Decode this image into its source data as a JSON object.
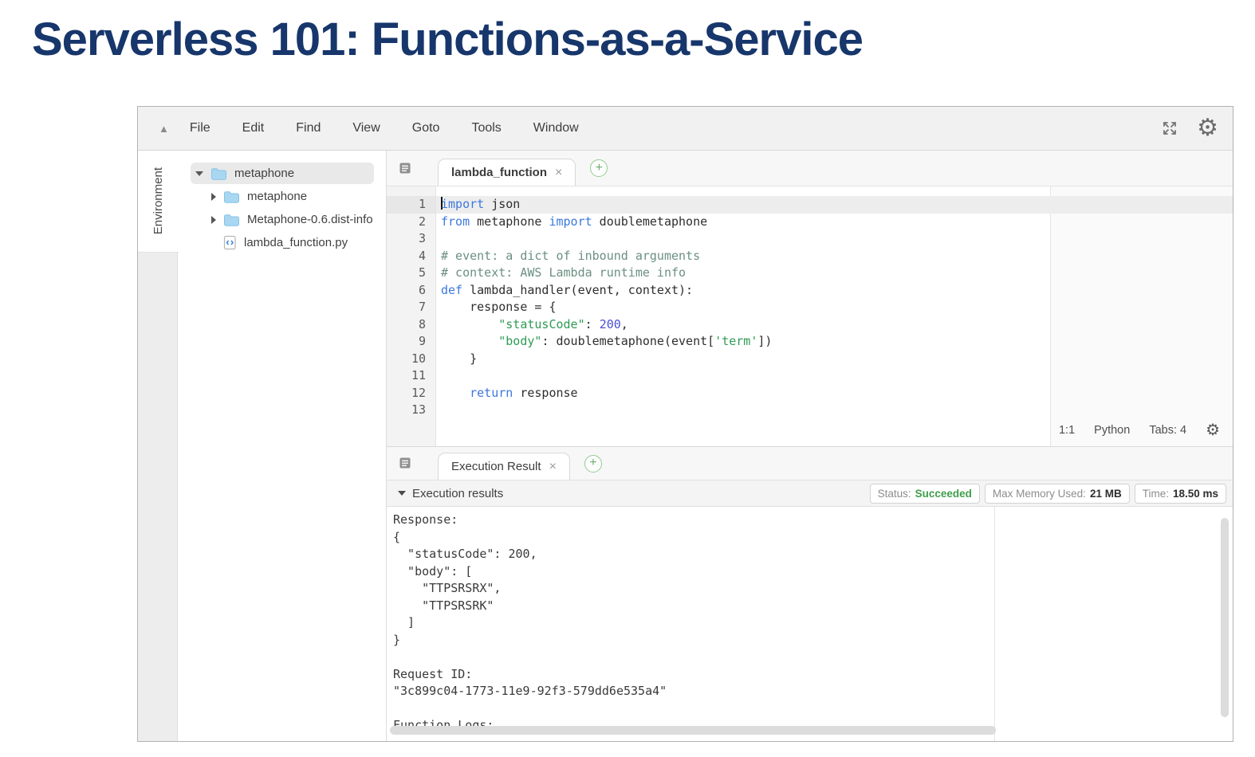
{
  "slide": {
    "title": "Serverless 101: Functions-as-a-Service"
  },
  "colors": {
    "title": "#17366b",
    "keyword": "#3c78dd",
    "string": "#2e9b54",
    "number": "#4a4fd0",
    "comment": "#6b9080",
    "status_green": "#3f9e49"
  },
  "menu_bar": {
    "collapse_icon": "▲",
    "items": [
      "File",
      "Edit",
      "Find",
      "View",
      "Goto",
      "Tools",
      "Window"
    ],
    "gear_icon": "⚙"
  },
  "sidebar": {
    "environment_tab": "Environment"
  },
  "file_tree": {
    "items": [
      {
        "label": "metaphone",
        "kind": "folder",
        "state": "expanded",
        "selected": true,
        "level": 0
      },
      {
        "label": "metaphone",
        "kind": "folder",
        "state": "collapsed",
        "selected": false,
        "level": 1
      },
      {
        "label": "Metaphone-0.6.dist-info",
        "kind": "folder",
        "state": "collapsed",
        "selected": false,
        "level": 1
      },
      {
        "label": "lambda_function.py",
        "kind": "file",
        "state": "none",
        "selected": false,
        "level": 1
      }
    ]
  },
  "editor": {
    "tab_label": "lambda_function",
    "tab_close": "×",
    "new_tab": "+",
    "code": [
      {
        "n": "1",
        "active": true,
        "tokens": [
          [
            "keyword",
            "import"
          ],
          [
            "text",
            " json"
          ]
        ]
      },
      {
        "n": "2",
        "active": false,
        "tokens": [
          [
            "keyword",
            "from"
          ],
          [
            "text",
            " metaphone "
          ],
          [
            "keyword",
            "import"
          ],
          [
            "text",
            " doublemetaphone"
          ]
        ]
      },
      {
        "n": "3",
        "active": false,
        "tokens": []
      },
      {
        "n": "4",
        "active": false,
        "tokens": [
          [
            "comment",
            "# event: a dict of inbound arguments"
          ]
        ]
      },
      {
        "n": "5",
        "active": false,
        "tokens": [
          [
            "comment",
            "# context: AWS Lambda runtime info"
          ]
        ]
      },
      {
        "n": "6",
        "active": false,
        "tokens": [
          [
            "keyword",
            "def"
          ],
          [
            "text",
            " lambda_handler(event, context):"
          ]
        ]
      },
      {
        "n": "7",
        "active": false,
        "tokens": [
          [
            "text",
            "    response = {"
          ]
        ]
      },
      {
        "n": "8",
        "active": false,
        "tokens": [
          [
            "text",
            "        "
          ],
          [
            "string",
            "\"statusCode\""
          ],
          [
            "text",
            ": "
          ],
          [
            "number",
            "200"
          ],
          [
            "text",
            ","
          ]
        ]
      },
      {
        "n": "9",
        "active": false,
        "tokens": [
          [
            "text",
            "        "
          ],
          [
            "string",
            "\"body\""
          ],
          [
            "text",
            ": doublemetaphone(event["
          ],
          [
            "string",
            "'term'"
          ],
          [
            "text",
            "])"
          ]
        ]
      },
      {
        "n": "10",
        "active": false,
        "tokens": [
          [
            "text",
            "    }"
          ]
        ]
      },
      {
        "n": "11",
        "active": false,
        "tokens": []
      },
      {
        "n": "12",
        "active": false,
        "tokens": [
          [
            "text",
            "    "
          ],
          [
            "keyword",
            "return"
          ],
          [
            "text",
            " response"
          ]
        ]
      },
      {
        "n": "13",
        "active": false,
        "tokens": []
      }
    ],
    "status_bar": {
      "cursor": "1:1",
      "language": "Python",
      "tabs": "Tabs: 4",
      "gear_icon": "⚙"
    }
  },
  "execution": {
    "tab_label": "Execution Result",
    "tab_close": "×",
    "new_tab": "+",
    "section_title": "Execution results",
    "badges": [
      {
        "label": "Status:",
        "value": "Succeeded",
        "green": true
      },
      {
        "label": "Max Memory Used:",
        "value": "21 MB",
        "green": false
      },
      {
        "label": "Time:",
        "value": "18.50 ms",
        "green": false
      }
    ],
    "output": [
      "Response:",
      "{",
      "  \"statusCode\": 200,",
      "  \"body\": [",
      "    \"TTPSRSRX\",",
      "    \"TTPSRSRK\"",
      "  ]",
      "}",
      "",
      "Request ID:",
      "\"3c899c04-1773-11e9-92f3-579dd6e535a4\"",
      "",
      "Function Logs:"
    ]
  }
}
